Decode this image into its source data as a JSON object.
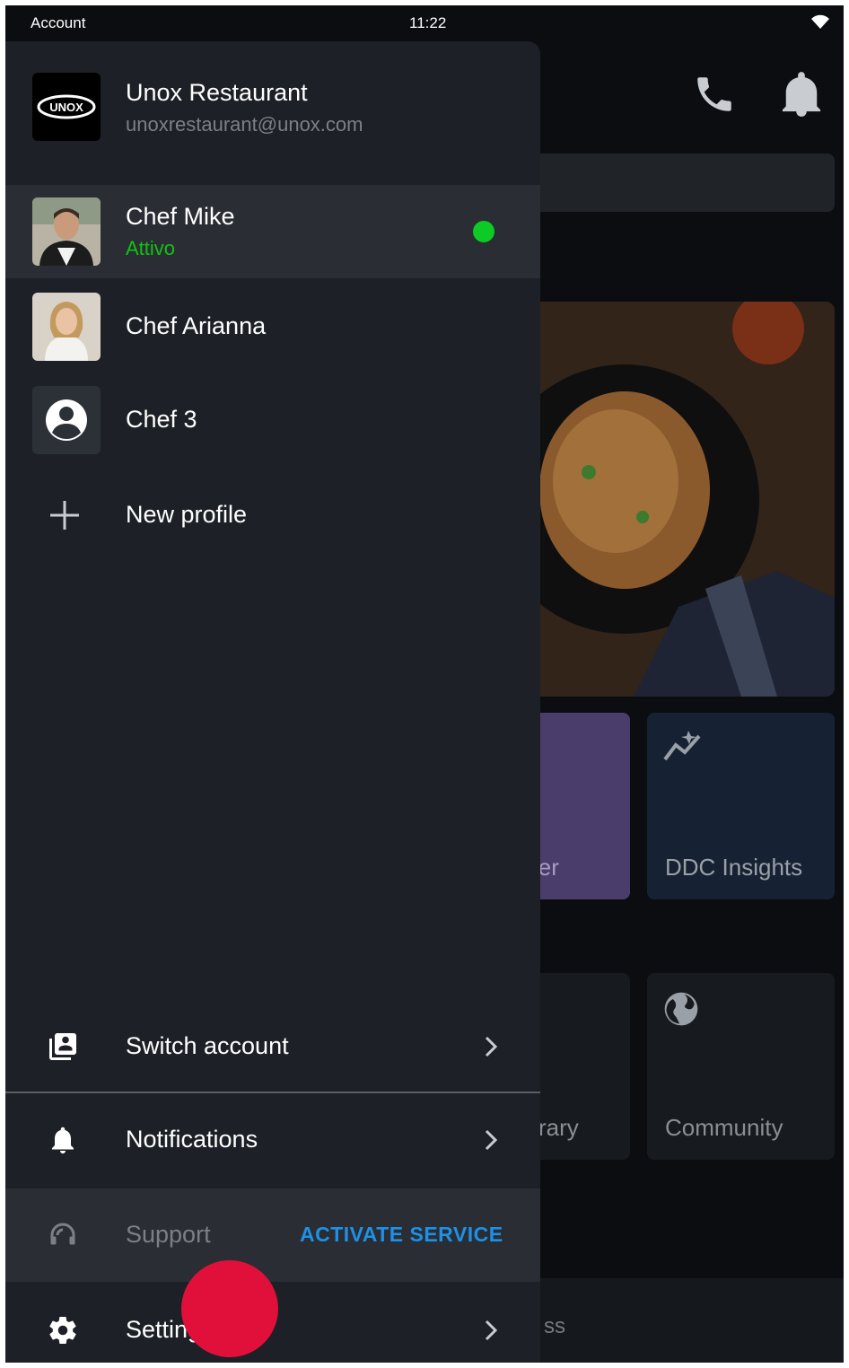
{
  "status_bar": {
    "left_label": "Account",
    "time": "11:22"
  },
  "account": {
    "name": "Unox Restaurant",
    "email": "unoxrestaurant@unox.com"
  },
  "profiles": [
    {
      "name": "Chef Mike",
      "status": "Attivo",
      "active": true
    },
    {
      "name": "Chef Arianna",
      "active": false
    },
    {
      "name": "Chef 3",
      "active": false
    }
  ],
  "new_profile_label": "New profile",
  "menu": {
    "switch_account": "Switch account",
    "notifications": "Notifications",
    "support": "Support",
    "activate_service": "ACTIVATE SERVICE",
    "settings": "Settings"
  },
  "background": {
    "tile_planner_partial": "ler",
    "tile_ddc": "DDC Insights",
    "tile_library_partial": "rary",
    "tile_community": "Community",
    "bottom_partial": "ss"
  },
  "colors": {
    "drawer_bg": "#1d2026",
    "active_row_bg": "#2a2d33",
    "status_green": "#13c213",
    "accent_blue": "#1e90e6",
    "tap_indicator": "#e0103a"
  }
}
